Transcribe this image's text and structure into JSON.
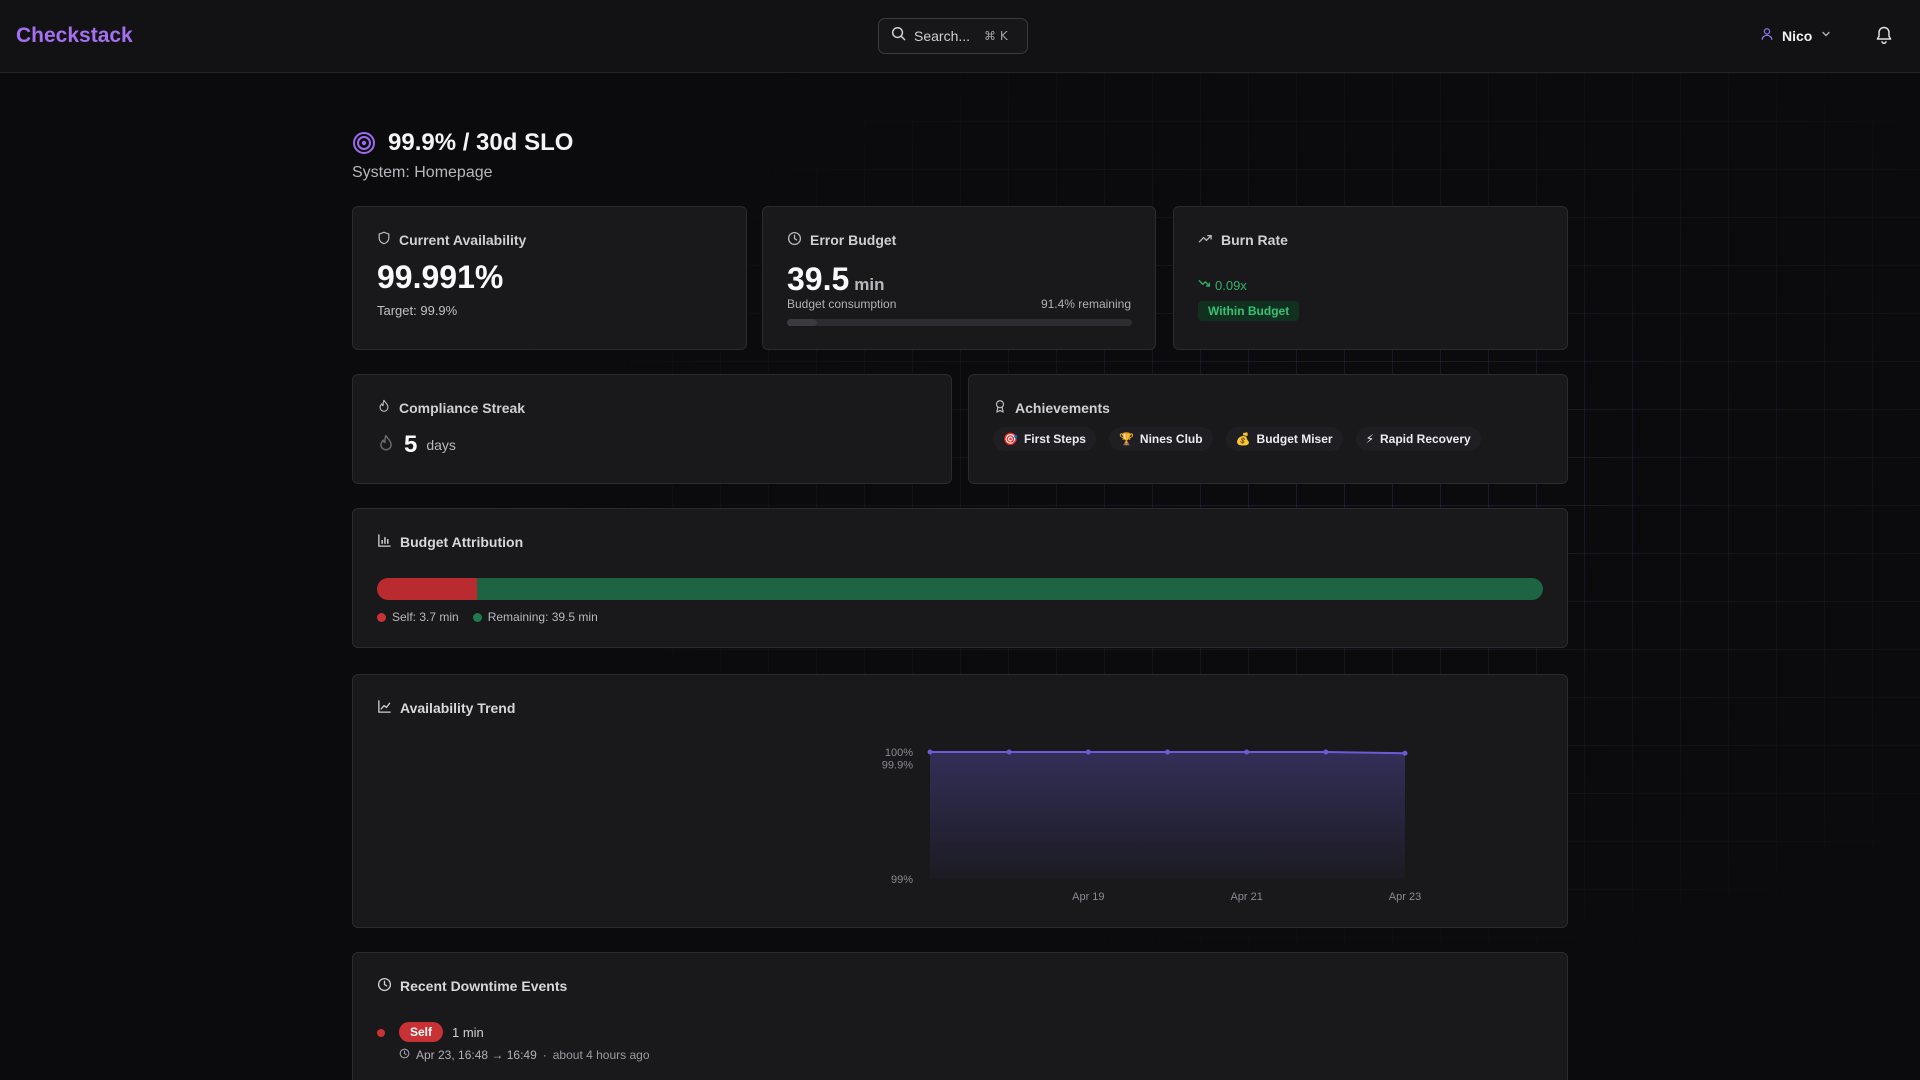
{
  "app": {
    "brand": "Checkstack"
  },
  "header": {
    "search_label": "Search...",
    "search_shortcut": "⌘ K",
    "user_name": "Nico"
  },
  "page": {
    "title": "99.9% / 30d SLO",
    "subtitle": "System: Homepage"
  },
  "availability": {
    "title": "Current Availability",
    "value": "99.991%",
    "target": "Target: 99.9%"
  },
  "error_budget": {
    "title": "Error Budget",
    "value": "39.5",
    "unit": "min",
    "consumption_label": "Budget consumption",
    "remaining_label": "91.4% remaining",
    "consumed_fraction": 0.086
  },
  "burn_rate": {
    "title": "Burn Rate",
    "value": "0.09x",
    "status": "Within Budget"
  },
  "streak": {
    "title": "Compliance Streak",
    "value": "5",
    "unit": "days"
  },
  "achievements": {
    "title": "Achievements",
    "items": [
      {
        "emoji": "🎯",
        "label": "First Steps"
      },
      {
        "emoji": "🏆",
        "label": "Nines Club"
      },
      {
        "emoji": "💰",
        "label": "Budget Miser"
      },
      {
        "emoji": "⚡",
        "label": "Rapid Recovery"
      }
    ]
  },
  "attribution": {
    "title": "Budget Attribution",
    "self_label": "Self: 3.7 min",
    "remaining_label": "Remaining: 39.5 min",
    "self_minutes": 3.7,
    "remaining_minutes": 39.5,
    "colors": {
      "self": "#b92b2e",
      "remaining": "#1c6442"
    }
  },
  "trend": {
    "title": "Availability Trend",
    "chart_data": {
      "type": "area",
      "x": [
        "Apr 17",
        "Apr 18",
        "Apr 19",
        "Apr 20",
        "Apr 21",
        "Apr 22",
        "Apr 23"
      ],
      "y_tick_labels": [
        "100%",
        "99.9%",
        "99%"
      ],
      "x_tick_labels": [
        "Apr 19",
        "Apr 21",
        "Apr 23"
      ],
      "values": [
        100,
        100,
        100,
        100,
        100,
        100,
        99.99
      ],
      "ylim": [
        99,
        100
      ],
      "color": "#6b5bd6",
      "grid": false
    }
  },
  "downtime": {
    "title": "Recent Downtime Events",
    "events": [
      {
        "badge": "Self",
        "duration": "1 min",
        "range": "Apr 23, 16:48 → 16:49",
        "ago": "about 4 hours ago"
      }
    ]
  }
}
